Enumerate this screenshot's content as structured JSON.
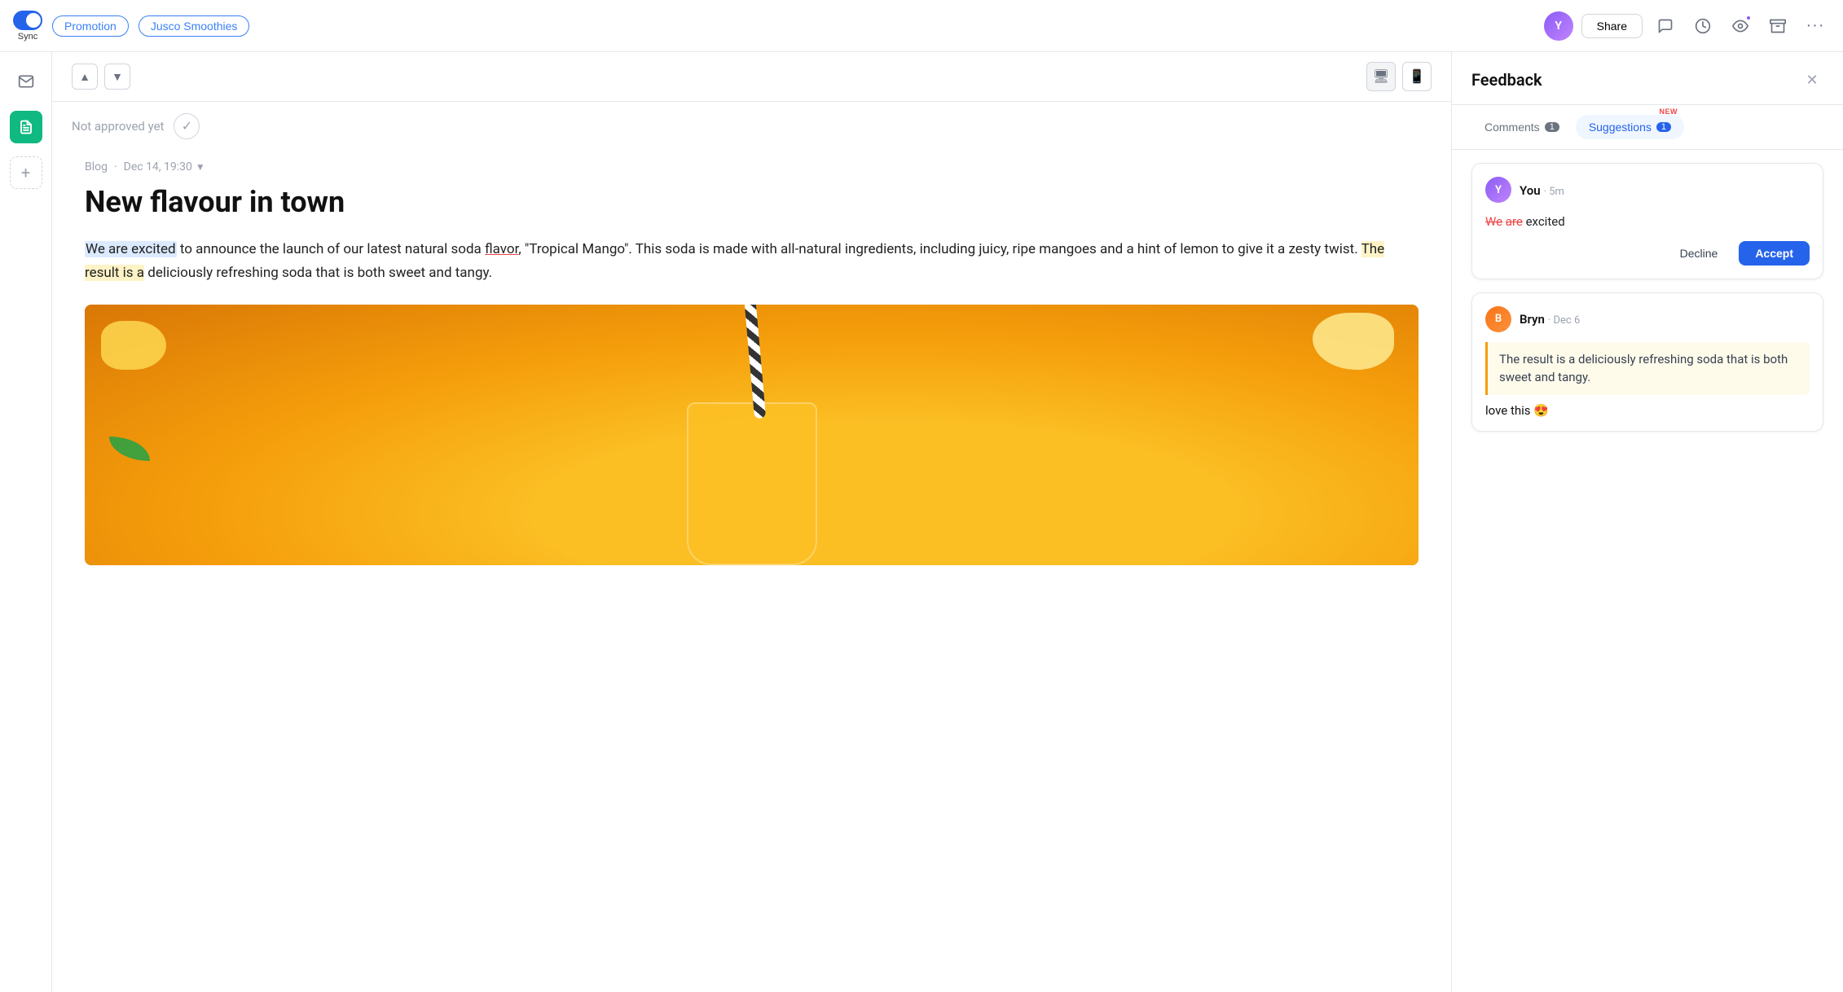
{
  "topbar": {
    "sync_label": "Sync",
    "tag_promotion": "Promotion",
    "tag_jusco": "Jusco Smoothies",
    "share_label": "Share",
    "avatar_initials": "Y"
  },
  "sidebar": {
    "mail_icon": "✉",
    "doc_icon": "📄",
    "add_icon": "+"
  },
  "toolbar": {
    "nav_up": "▲",
    "nav_down": "▼",
    "view_desktop": "🖥",
    "view_mobile": "📱"
  },
  "approval": {
    "text": "Not approved yet",
    "check_icon": "✓"
  },
  "document": {
    "meta_type": "Blog",
    "meta_date": "Dec 14, 19:30",
    "title": "New flavour in town",
    "body_highlight": "We are excited",
    "body_main": " to announce the launch of our latest natural soda flavor, \"Tropical Mango\". This soda is made with all-natural ingredients, including juicy, ripe mangoes and a hint of lemon to give it a zesty twist. ",
    "body_highlight2": "The result is a",
    "body_end": " deliciously refreshing soda that is both sweet and tangy."
  },
  "panel": {
    "title": "Feedback",
    "close_icon": "✕",
    "tabs": [
      {
        "label": "Comments",
        "badge": "1",
        "active": false
      },
      {
        "label": "Suggestions",
        "badge": "1",
        "active": true,
        "new_label": "NEW"
      }
    ],
    "suggestion": {
      "author": "You",
      "time": "5m",
      "strikethrough": "We",
      "strikethrough2": "are",
      "inserted": "We are excited",
      "decline_label": "Decline",
      "accept_label": "Accept"
    },
    "comment": {
      "author": "Bryn",
      "time": "Dec 6",
      "quote": "The result is a deliciously refreshing soda that is both sweet and tangy.",
      "body": "love this 😍"
    }
  }
}
